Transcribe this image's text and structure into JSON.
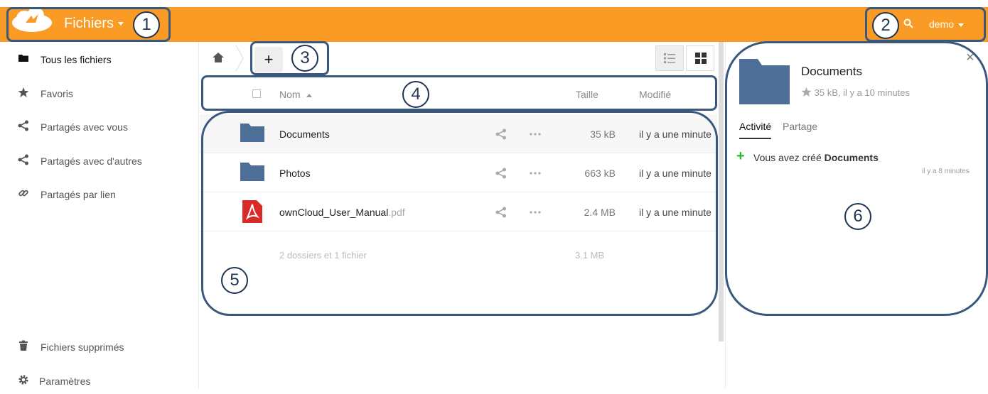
{
  "colors": {
    "brand": "#f99b24",
    "folder": "#4d6e96",
    "pdf": "#d82a29",
    "activity_plus": "#2eb82e",
    "annotation": "#1f3553"
  },
  "header": {
    "app_title": "Fichiers",
    "user": "demo"
  },
  "annotations": [
    "1",
    "2",
    "3",
    "4",
    "5",
    "6"
  ],
  "sidebar": {
    "items": [
      {
        "label": "Tous les fichiers",
        "icon": "folder-icon"
      },
      {
        "label": "Favoris",
        "icon": "star-icon"
      },
      {
        "label": "Partagés avec vous",
        "icon": "share-icon"
      },
      {
        "label": "Partagés avec d'autres",
        "icon": "share-icon"
      },
      {
        "label": "Partagés par lien",
        "icon": "link-icon"
      }
    ],
    "bottom": [
      {
        "label": "Fichiers supprimés",
        "icon": "trash-icon"
      },
      {
        "label": "Paramètres",
        "icon": "gear-icon"
      }
    ]
  },
  "toolbar": {
    "new_label": "+"
  },
  "table": {
    "headers": {
      "name": "Nom",
      "size": "Taille",
      "modified": "Modifié"
    },
    "rows": [
      {
        "name": "Documents",
        "ext": "",
        "type": "folder",
        "size": "35 kB",
        "modified": "il y a une minute"
      },
      {
        "name": "Photos",
        "ext": "",
        "type": "folder",
        "size": "663 kB",
        "modified": "il y a une minute"
      },
      {
        "name": "ownCloud_User_Manual",
        "ext": ".pdf",
        "type": "pdf",
        "size": "2.4 MB",
        "modified": "il y a une minute"
      }
    ],
    "summary": {
      "text": "2 dossiers et 1 fichier",
      "size": "3.1 MB"
    }
  },
  "details": {
    "title": "Documents",
    "meta": "35 kB, il y a 10 minutes",
    "tabs": [
      "Activité",
      "Partage"
    ],
    "activity": {
      "prefix": "Vous avez créé ",
      "target": "Documents",
      "time": "il y a 8 minutes"
    },
    "close": "×"
  }
}
